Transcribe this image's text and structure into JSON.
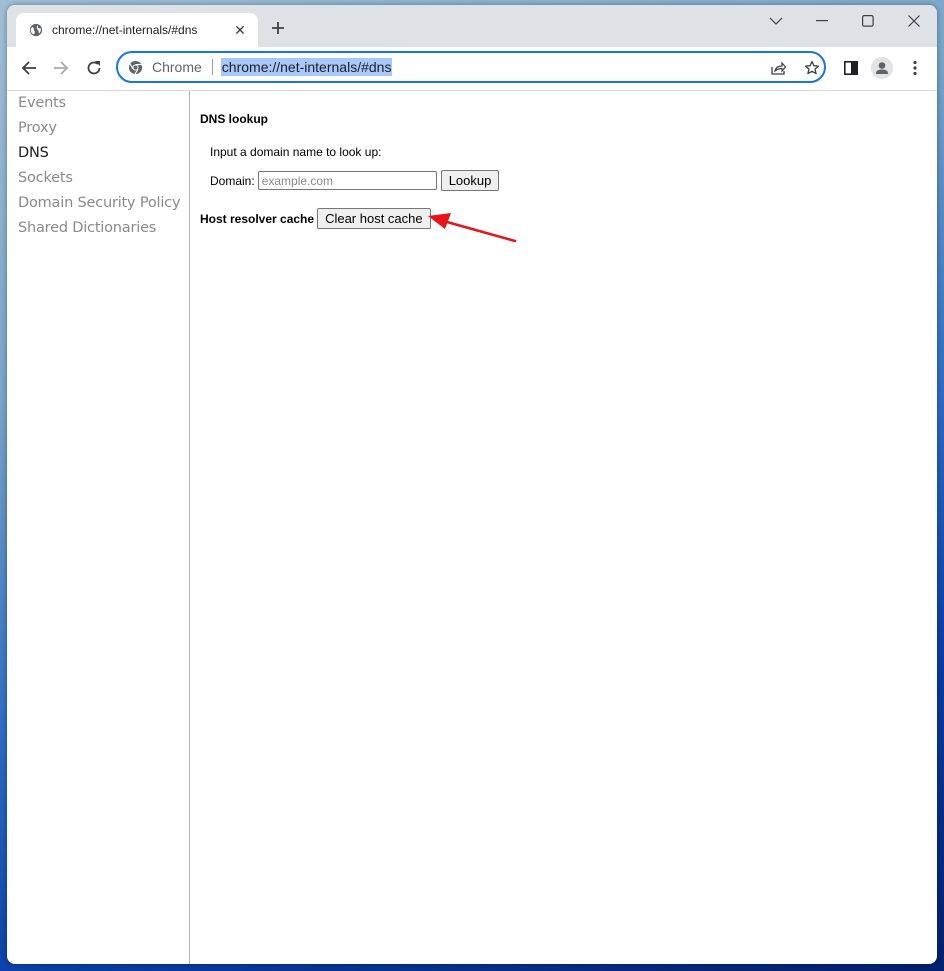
{
  "browser": {
    "tab": {
      "title": "chrome://net-internals/#dns",
      "favicon": "globe-icon"
    },
    "new_tab_icon": "plus-icon",
    "window_controls": [
      "chevron-down-icon",
      "minimize-icon",
      "maximize-icon",
      "close-icon"
    ],
    "nav": {
      "back": "back-arrow-icon",
      "forward": "forward-arrow-icon",
      "reload": "reload-icon"
    },
    "omnibox": {
      "chip_label": "Chrome",
      "url": "chrome://net-internals/#dns"
    },
    "toolbar_icons": [
      "share-icon",
      "bookmark-star-icon",
      "side-panel-icon",
      "profile-icon",
      "menu-kebab-icon"
    ]
  },
  "sidebar": {
    "items": [
      {
        "label": "Events",
        "active": false
      },
      {
        "label": "Proxy",
        "active": false
      },
      {
        "label": "DNS",
        "active": true
      },
      {
        "label": "Sockets",
        "active": false
      },
      {
        "label": "Domain Security Policy",
        "active": false
      },
      {
        "label": "Shared Dictionaries",
        "active": false
      }
    ]
  },
  "dns": {
    "heading": "DNS lookup",
    "intro": "Input a domain name to look up:",
    "domain_label": "Domain:",
    "domain_value": "",
    "domain_placeholder": "example.com",
    "lookup_button": "Lookup",
    "host_cache_label": "Host resolver cache",
    "clear_cache_button": "Clear host cache"
  },
  "annotation": {
    "type": "arrow",
    "color": "#e8141c",
    "points_to": "clear-host-cache-button"
  }
}
